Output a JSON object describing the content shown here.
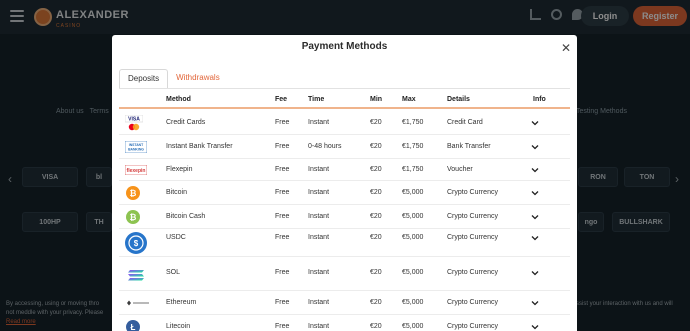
{
  "header": {
    "logo_text": "ALEXANDER",
    "logo_sub": "CASINO",
    "login_label": "Login",
    "register_label": "Register"
  },
  "background": {
    "links": [
      "About us",
      "Terms"
    ],
    "right_link": "Testing Methods",
    "tiles": [
      "VISA",
      "bl",
      "RON",
      "TON",
      "100HP",
      "TH",
      "ngo",
      "BULLSHARK"
    ],
    "footer_left": "By accessing, using or moving thro",
    "footer_left_2": "not meddle with your privacy. Please",
    "read_more": "Read more",
    "footer_right": "ssist your interaction with us and will"
  },
  "modal": {
    "title": "Payment Methods",
    "tabs": [
      {
        "label": "Deposits",
        "active": true
      },
      {
        "label": "Withdrawals",
        "active": false
      }
    ],
    "columns": [
      "Method",
      "Fee",
      "Time",
      "Min",
      "Max",
      "Details",
      "Info"
    ],
    "rows": [
      {
        "icon": "visa-mastercard-icon",
        "method": "Credit Cards",
        "fee": "Free",
        "time": "Instant",
        "min": "€20",
        "max": "€1,750",
        "details": "Credit Card"
      },
      {
        "icon": "instant-banking-icon",
        "method": "Instant Bank Transfer",
        "fee": "Free",
        "time": "0-48 hours",
        "min": "€20",
        "max": "€1,750",
        "details": "Bank Transfer"
      },
      {
        "icon": "flexepin-icon",
        "method": "Flexepin",
        "fee": "Free",
        "time": "Instant",
        "min": "€20",
        "max": "€1,750",
        "details": "Voucher"
      },
      {
        "icon": "bitcoin-icon",
        "method": "Bitcoin",
        "fee": "Free",
        "time": "Instant",
        "min": "€20",
        "max": "€5,000",
        "details": "Crypto Currency"
      },
      {
        "icon": "bitcoin-cash-icon",
        "method": "Bitcoin Cash",
        "fee": "Free",
        "time": "Instant",
        "min": "€20",
        "max": "€5,000",
        "details": "Crypto Currency"
      },
      {
        "icon": "usdc-icon",
        "method": "USDC",
        "fee": "Free",
        "time": "Instant",
        "min": "€20",
        "max": "€5,000",
        "details": "Crypto Currency"
      },
      {
        "icon": "solana-icon",
        "method": "SOL",
        "fee": "Free",
        "time": "Instant",
        "min": "€20",
        "max": "€5,000",
        "details": "Crypto Currency"
      },
      {
        "icon": "ethereum-icon",
        "method": "Ethereum",
        "fee": "Free",
        "time": "Instant",
        "min": "€20",
        "max": "€5,000",
        "details": "Crypto Currency"
      },
      {
        "icon": "litecoin-icon",
        "method": "Litecoin",
        "fee": "Free",
        "time": "Instant",
        "min": "€20",
        "max": "€5,000",
        "details": "Crypto Currency"
      }
    ]
  },
  "colors": {
    "accent": "#e2663a",
    "page_bg": "#17232b",
    "header_bg": "#1f2d36",
    "table_rule": "#f0b48c"
  }
}
